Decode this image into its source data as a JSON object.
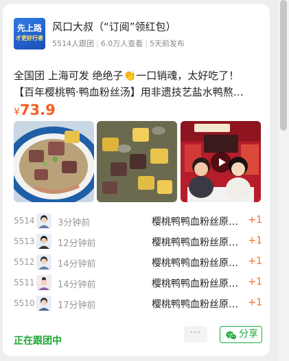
{
  "shop": {
    "logo_line1": "先上路",
    "logo_line2": "才更好行者",
    "name": "风口大叔（“订阅”领红包）",
    "followers": "5514人跟团",
    "views": "6.0万人查看",
    "published": "5天前发布"
  },
  "product": {
    "title_line1": "全国团 上海可发 绝绝子👏一口销魂，太好吃了！",
    "title_line2": "【百年樱桃鸭·鸭血粉丝汤】用非遗技艺盐水鸭熬…",
    "price_currency": "¥",
    "price_value": "73.9"
  },
  "photos": [
    {
      "icon": "duck-blood-soup-photo"
    },
    {
      "icon": "tofu-duck-blood-photo"
    },
    {
      "icon": "livestream-video-thumbnail",
      "video": true
    }
  ],
  "orders": [
    {
      "seq": "5514",
      "time": "3分钟前",
      "item": "樱桃鸭鸭血粉丝原…",
      "qty": "+1"
    },
    {
      "seq": "5513",
      "time": "12分钟前",
      "item": "樱桃鸭鸭血粉丝原…",
      "qty": "+1"
    },
    {
      "seq": "5512",
      "time": "14分钟前",
      "item": "樱桃鸭鸭血粉丝原…",
      "qty": "+1"
    },
    {
      "seq": "5511",
      "time": "14分钟前",
      "item": "樱桃鸭鸭血粉丝原…",
      "qty": "+1"
    },
    {
      "seq": "5510",
      "time": "17分钟前",
      "item": "樱桃鸭鸭血粉丝原…",
      "qty": "+1"
    }
  ],
  "footer": {
    "status": "正在跟团中",
    "more_label": "···",
    "share_label": "分享"
  },
  "colors": {
    "accent_price": "#fa5a1e",
    "accent_green": "#19ad3a"
  }
}
